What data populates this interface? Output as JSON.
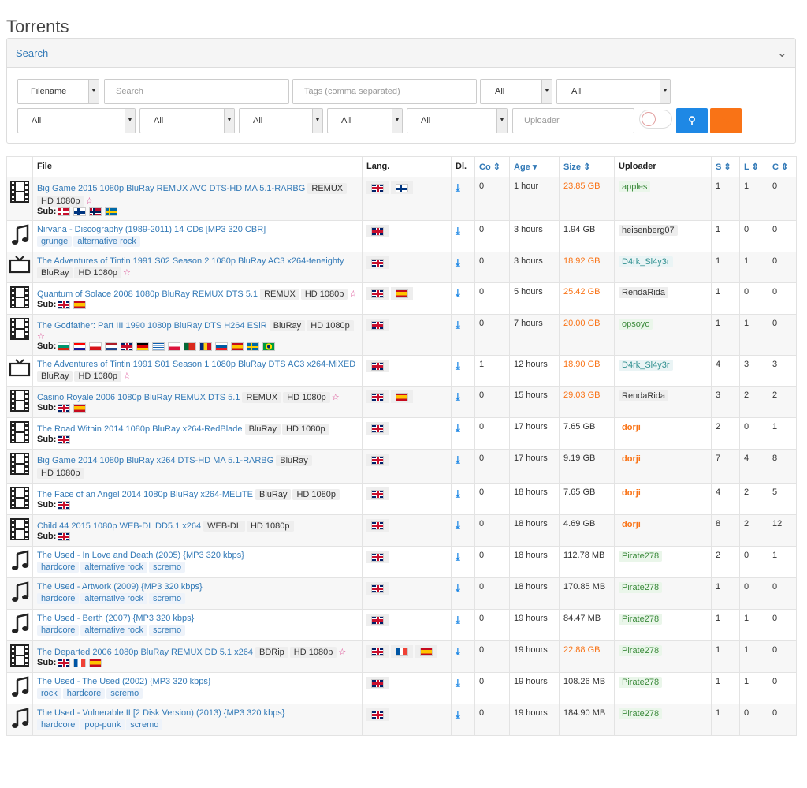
{
  "page": {
    "title": "Torrents"
  },
  "search": {
    "panel_label": "Search",
    "field_select": "Filename",
    "query_placeholder": "Search",
    "tags_placeholder": "Tags (comma separated)",
    "filter_a": "All",
    "filter_b": "All",
    "filter_c": "All",
    "filter_d": "All",
    "filter_e": "All",
    "filter_f": "All",
    "filter_g": "All",
    "uploader_placeholder": "Uploader"
  },
  "table": {
    "headers": [
      "File",
      "Lang.",
      "Dl.",
      "Co",
      "Age",
      "Size",
      "Uploader",
      "S",
      "L",
      "C"
    ],
    "rows": [
      {
        "cat": "movie",
        "name": "Big Game 2015 1080p BluRay REMUX AVC DTS-HD MA 5.1-RARBG",
        "tags": [
          "REMUX",
          "HD 1080p"
        ],
        "star": true,
        "genres": [],
        "subs": [
          "dk",
          "fi",
          "no",
          "se"
        ],
        "langs": [
          "uk",
          "fi"
        ],
        "co": "0",
        "age": "1 hour",
        "size": "23.85 GB",
        "size_color": "#f97316",
        "uploader": "apples",
        "up_style": "green",
        "s": "1",
        "l": "1",
        "c": "0"
      },
      {
        "cat": "music",
        "name": "Nirvana - Discography (1989-2011) 14 CDs [MP3 320 CBR]",
        "tags": [],
        "star": false,
        "genres": [
          "grunge",
          "alternative rock"
        ],
        "subs": [],
        "langs": [
          "uk"
        ],
        "co": "0",
        "age": "3 hours",
        "size": "1.94 GB",
        "size_color": "#333333",
        "uploader": "heisenberg07",
        "up_style": "plain",
        "s": "1",
        "l": "0",
        "c": "0"
      },
      {
        "cat": "tv",
        "name": "The Adventures of Tintin 1991 S02 Season 2 1080p BluRay AC3 x264-teneighty",
        "tags": [
          "BluRay",
          "HD 1080p"
        ],
        "star": true,
        "genres": [],
        "subs": [],
        "langs": [
          "uk"
        ],
        "co": "0",
        "age": "3 hours",
        "size": "18.92 GB",
        "size_color": "#f97316",
        "uploader": "D4rk_Sl4y3r",
        "up_style": "teal",
        "s": "1",
        "l": "1",
        "c": "0"
      },
      {
        "cat": "movie",
        "name": "Quantum of Solace 2008 1080p BluRay REMUX DTS 5.1",
        "tags": [
          "REMUX",
          "HD 1080p"
        ],
        "star": true,
        "genres": [],
        "subs": [
          "uk",
          "es"
        ],
        "langs": [
          "uk",
          "es"
        ],
        "co": "0",
        "age": "5 hours",
        "size": "25.42 GB",
        "size_color": "#f97316",
        "uploader": "RendaRida",
        "up_style": "plain",
        "s": "1",
        "l": "0",
        "c": "0"
      },
      {
        "cat": "movie",
        "name": "The Godfather: Part III 1990 1080p BluRay DTS H264 ESiR",
        "tags": [
          "BluRay",
          "HD 1080p"
        ],
        "star": true,
        "genres": [],
        "subs": [
          "bg",
          "hr",
          "cz",
          "nl",
          "uk",
          "de",
          "gr",
          "pl",
          "pt",
          "ro",
          "si",
          "es",
          "se",
          "br"
        ],
        "langs": [
          "uk"
        ],
        "co": "0",
        "age": "7 hours",
        "size": "20.00 GB",
        "size_color": "#f97316",
        "uploader": "opsoyo",
        "up_style": "green",
        "s": "1",
        "l": "1",
        "c": "0"
      },
      {
        "cat": "tv",
        "name": "The Adventures of Tintin 1991 S01 Season 1 1080p BluRay DTS AC3 x264-MiXED",
        "tags": [
          "BluRay",
          "HD 1080p"
        ],
        "star": true,
        "genres": [],
        "subs": [],
        "langs": [
          "uk"
        ],
        "co": "1",
        "age": "12 hours",
        "size": "18.90 GB",
        "size_color": "#f97316",
        "uploader": "D4rk_Sl4y3r",
        "up_style": "teal",
        "s": "4",
        "l": "3",
        "c": "3"
      },
      {
        "cat": "movie",
        "name": "Casino Royale 2006 1080p BluRay REMUX DTS 5.1",
        "tags": [
          "REMUX",
          "HD 1080p"
        ],
        "star": true,
        "genres": [],
        "subs": [
          "uk",
          "es"
        ],
        "langs": [
          "uk",
          "es"
        ],
        "co": "0",
        "age": "15 hours",
        "size": "29.03 GB",
        "size_color": "#f97316",
        "uploader": "RendaRida",
        "up_style": "plain",
        "s": "3",
        "l": "2",
        "c": "2"
      },
      {
        "cat": "movie",
        "name": "The Road Within 2014 1080p BluRay x264-RedBlade",
        "tags": [
          "BluRay",
          "HD 1080p"
        ],
        "star": false,
        "genres": [],
        "subs": [
          "uk"
        ],
        "langs": [
          "uk"
        ],
        "co": "0",
        "age": "17 hours",
        "size": "7.65 GB",
        "size_color": "#333333",
        "uploader": "dorji",
        "up_style": "red",
        "s": "2",
        "l": "0",
        "c": "1"
      },
      {
        "cat": "movie",
        "name": "Big Game 2014 1080p BluRay x264 DTS-HD MA 5.1-RARBG",
        "tags": [
          "BluRay",
          "HD 1080p"
        ],
        "star": false,
        "genres": [],
        "subs": [],
        "langs": [
          "uk"
        ],
        "co": "0",
        "age": "17 hours",
        "size": "9.19 GB",
        "size_color": "#333333",
        "uploader": "dorji",
        "up_style": "red",
        "s": "7",
        "l": "4",
        "c": "8"
      },
      {
        "cat": "movie",
        "name": "The Face of an Angel 2014 1080p BluRay x264-MELiTE",
        "tags": [
          "BluRay",
          "HD 1080p"
        ],
        "star": false,
        "genres": [],
        "subs": [
          "uk"
        ],
        "langs": [
          "uk"
        ],
        "co": "0",
        "age": "18 hours",
        "size": "7.65 GB",
        "size_color": "#333333",
        "uploader": "dorji",
        "up_style": "red",
        "s": "4",
        "l": "2",
        "c": "5"
      },
      {
        "cat": "movie",
        "name": "Child 44 2015 1080p WEB-DL DD5.1 x264",
        "tags": [
          "WEB-DL",
          "HD 1080p"
        ],
        "star": false,
        "genres": [],
        "subs": [
          "uk"
        ],
        "langs": [
          "uk"
        ],
        "co": "0",
        "age": "18 hours",
        "size": "4.69 GB",
        "size_color": "#333333",
        "uploader": "dorji",
        "up_style": "red",
        "s": "8",
        "l": "2",
        "c": "12"
      },
      {
        "cat": "music",
        "name": "The Used - In Love and Death (2005) {MP3 320 kbps}",
        "tags": [],
        "star": false,
        "genres": [
          "hardcore",
          "alternative rock",
          "scremo"
        ],
        "subs": [],
        "langs": [
          "uk"
        ],
        "co": "0",
        "age": "18 hours",
        "size": "112.78 MB",
        "size_color": "#333333",
        "uploader": "Pirate278",
        "up_style": "green",
        "s": "2",
        "l": "0",
        "c": "1"
      },
      {
        "cat": "music",
        "name": "The Used - Artwork (2009) {MP3 320 kbps}",
        "tags": [],
        "star": false,
        "genres": [
          "hardcore",
          "alternative rock",
          "scremo"
        ],
        "subs": [],
        "langs": [
          "uk"
        ],
        "co": "0",
        "age": "18 hours",
        "size": "170.85 MB",
        "size_color": "#333333",
        "uploader": "Pirate278",
        "up_style": "green",
        "s": "1",
        "l": "0",
        "c": "0"
      },
      {
        "cat": "music",
        "name": "The Used - Berth (2007) {MP3 320 kbps}",
        "tags": [],
        "star": false,
        "genres": [
          "hardcore",
          "alternative rock",
          "scremo"
        ],
        "subs": [],
        "langs": [
          "uk"
        ],
        "co": "0",
        "age": "19 hours",
        "size": "84.47 MB",
        "size_color": "#333333",
        "uploader": "Pirate278",
        "up_style": "green",
        "s": "1",
        "l": "1",
        "c": "0"
      },
      {
        "cat": "movie",
        "name": "The Departed 2006 1080p BluRay REMUX DD 5.1 x264",
        "tags": [
          "BDRip",
          "HD 1080p"
        ],
        "star": true,
        "genres": [],
        "subs": [
          "uk",
          "fr",
          "es"
        ],
        "langs": [
          "uk",
          "fr",
          "es"
        ],
        "co": "0",
        "age": "19 hours",
        "size": "22.88 GB",
        "size_color": "#f97316",
        "uploader": "Pirate278",
        "up_style": "green",
        "s": "1",
        "l": "1",
        "c": "0"
      },
      {
        "cat": "music",
        "name": "The Used - The Used (2002) {MP3 320 kbps}",
        "tags": [],
        "star": false,
        "genres": [
          "rock",
          "hardcore",
          "scremo"
        ],
        "subs": [],
        "langs": [
          "uk"
        ],
        "co": "0",
        "age": "19 hours",
        "size": "108.26 MB",
        "size_color": "#333333",
        "uploader": "Pirate278",
        "up_style": "green",
        "s": "1",
        "l": "1",
        "c": "0"
      },
      {
        "cat": "music",
        "name": "The Used - Vulnerable II [2 Disk Version) (2013) {MP3 320 kbps}",
        "tags": [],
        "star": false,
        "genres": [
          "hardcore",
          "pop-punk",
          "scremo"
        ],
        "subs": [],
        "langs": [
          "uk"
        ],
        "co": "0",
        "age": "19 hours",
        "size": "184.90 MB",
        "size_color": "#333333",
        "uploader": "Pirate278",
        "up_style": "green",
        "s": "1",
        "l": "0",
        "c": "0"
      }
    ]
  },
  "labels": {
    "sub": "Sub:"
  }
}
